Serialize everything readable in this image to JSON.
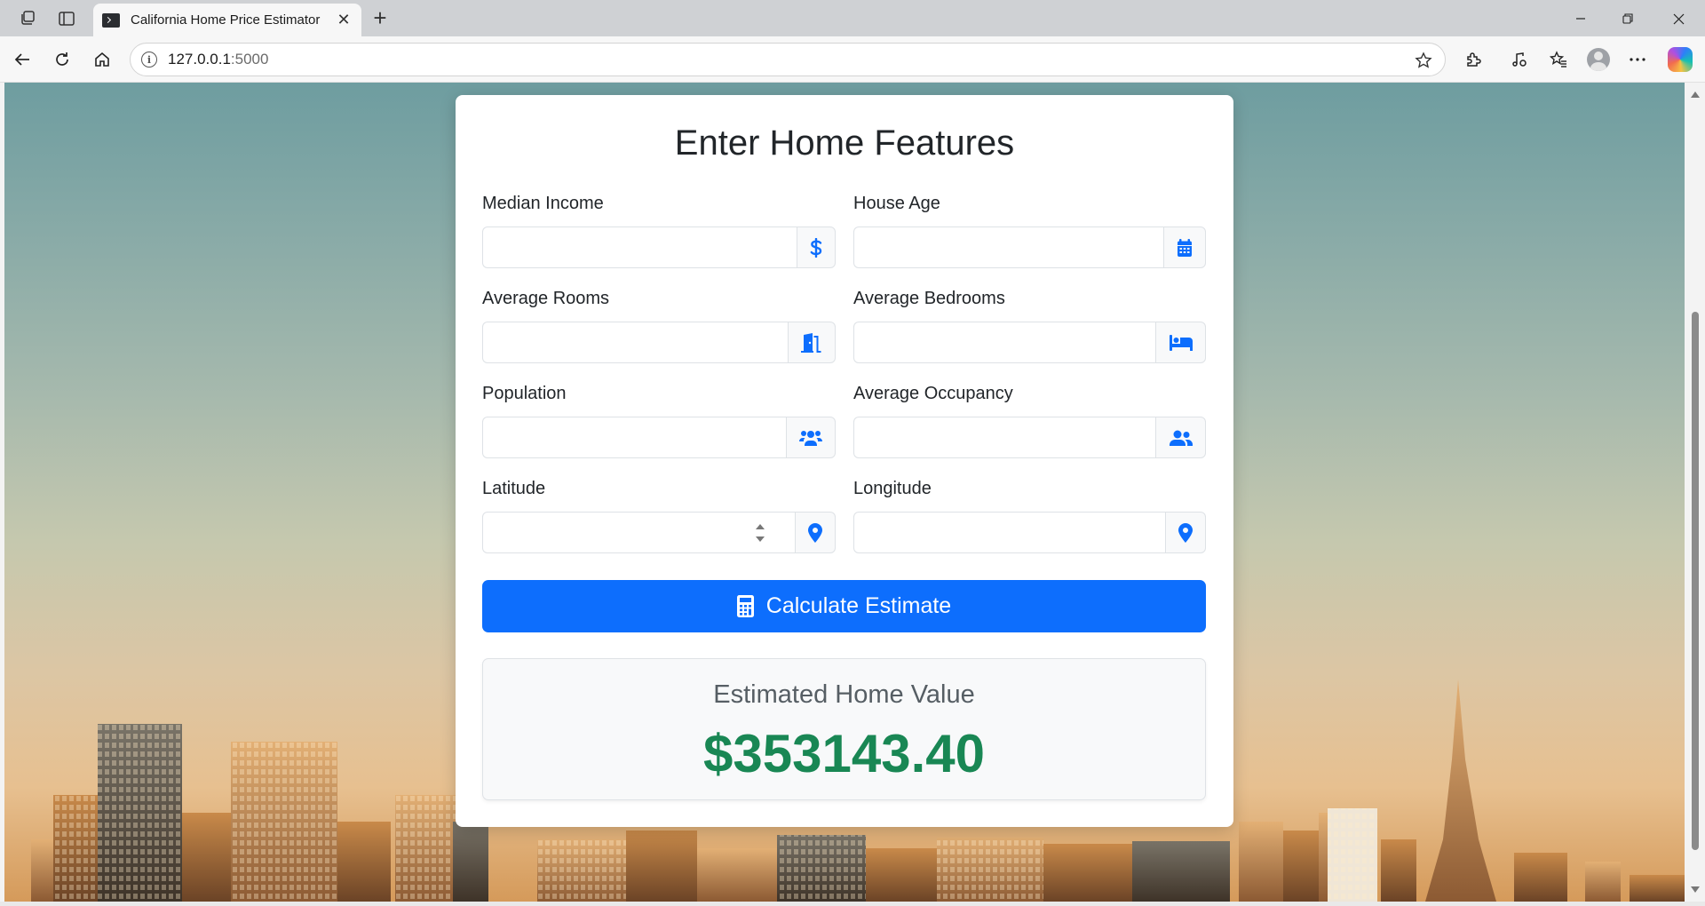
{
  "browser": {
    "tab_title": "California Home Price Estimator",
    "address_host": "127.0.0.1",
    "address_port": ":5000"
  },
  "form": {
    "title": "Enter Home Features",
    "fields": [
      {
        "label": "Median Income",
        "value": "",
        "icon": "dollar-icon"
      },
      {
        "label": "House Age",
        "value": "",
        "icon": "calendar-icon"
      },
      {
        "label": "Average Rooms",
        "value": "",
        "icon": "door-icon"
      },
      {
        "label": "Average Bedrooms",
        "value": "",
        "icon": "bed-icon"
      },
      {
        "label": "Population",
        "value": "",
        "icon": "users-icon"
      },
      {
        "label": "Average Occupancy",
        "value": "",
        "icon": "user-group-icon"
      },
      {
        "label": "Latitude",
        "value": "",
        "icon": "location-pin-icon"
      },
      {
        "label": "Longitude",
        "value": "",
        "icon": "location-pin-icon"
      }
    ],
    "submit_label": "Calculate Estimate"
  },
  "result": {
    "title": "Estimated Home Value",
    "value": "$353143.40"
  },
  "colors": {
    "primary": "#0d6efd",
    "success": "#198754",
    "icon": "#0d6efd"
  }
}
